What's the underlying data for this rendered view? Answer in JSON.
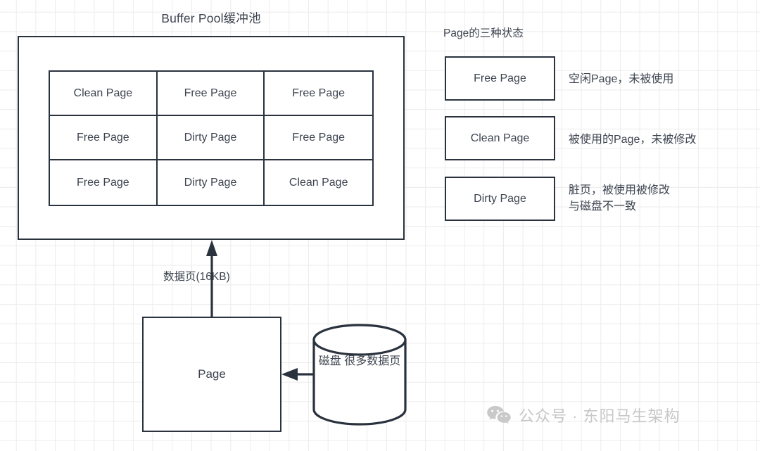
{
  "diagram": {
    "pool": {
      "title": "Buffer Pool缓冲池",
      "grid_cells": [
        "Clean Page",
        "Free Page",
        "Free Page",
        "Free Page",
        "Dirty Page",
        "Free Page",
        "Free Page",
        "Dirty Page",
        "Clean Page"
      ]
    },
    "states_panel": {
      "title": "Page的三种状态",
      "items": [
        {
          "box_label": "Free Page",
          "description": "空闲Page，未被使用"
        },
        {
          "box_label": "Clean Page",
          "description": "被使用的Page，未被修改"
        },
        {
          "box_label": "Dirty Page",
          "description": "脏页，被使用被修改\n与磁盘不一致"
        }
      ]
    },
    "flow": {
      "arrow_label": "数据页(16KB)",
      "page_box_label": "Page",
      "disk_label": "磁盘\n很多数据页"
    },
    "watermark": {
      "text": "公众号 · 东阳马生架构",
      "icon": "wechat-icon"
    },
    "colors": {
      "stroke": "#2a323e",
      "text": "#3d4450",
      "grid_line": "#ececec",
      "background": "#ffffff",
      "watermark": "#c7c7c7"
    }
  }
}
